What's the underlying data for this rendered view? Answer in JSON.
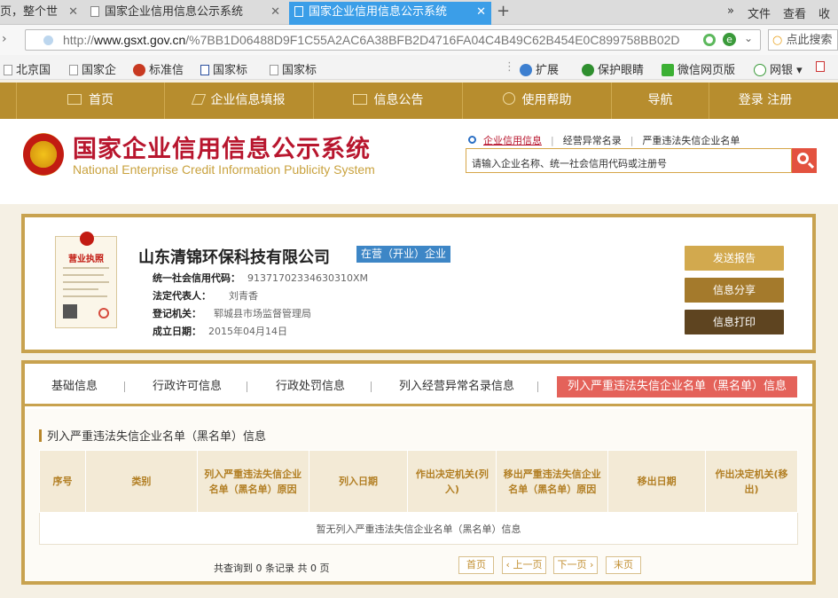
{
  "browser": {
    "tabs": [
      {
        "label": "页，整个世",
        "active": false
      },
      {
        "label": "国家企业信用信息公示系统",
        "active": false
      },
      {
        "label": "国家企业信用信息公示系统",
        "active": true
      }
    ],
    "new_tab": "+",
    "close": "✕",
    "menu": {
      "chevron": "»",
      "file": "文件",
      "view": "查看",
      "more": "收"
    },
    "url_prefix": "http://",
    "url_host": "www.gsxt.gov.cn",
    "url_path": "/%7BB1D06488D9F1C55A2AC6A38BFB2D4716FA04C4B49C62B454E0C899758BB02D",
    "search_placeholder": "点此搜索",
    "bookmarks": [
      "北京国",
      "国家企",
      "标准信",
      "国家标",
      "国家标"
    ],
    "right_tools": [
      "扩展",
      "保护眼睛",
      "微信网页版",
      "网银"
    ]
  },
  "nav": {
    "items": [
      "首页",
      "企业信息填报",
      "信息公告",
      "使用帮助",
      "导航"
    ],
    "login": "登录",
    "register": "注册"
  },
  "header": {
    "title": "国家企业信用信息公示系统",
    "subtitle": "National Enterprise Credit Information Publicity System",
    "search_tabs": [
      "企业信用信息",
      "经营异常名录",
      "严重违法失信企业名单"
    ],
    "search_placeholder": "请输入企业名称、统一社会信用代码或注册号"
  },
  "company": {
    "license_title": "营业执照",
    "name": "山东清锦环保科技有限公司",
    "status": "在营（开业）企业",
    "fields": [
      {
        "label": "统一社会信用代码：",
        "value": "91371702334630310XM"
      },
      {
        "label": "法定代表人：",
        "value": "刘青香"
      },
      {
        "label": "登记机关：",
        "value": "郓城县市场监督管理局"
      },
      {
        "label": "成立日期：",
        "value": "2015年04月14日"
      }
    ],
    "actions": [
      "发送报告",
      "信息分享",
      "信息打印"
    ],
    "action_colors": [
      "#d2a94e",
      "#a47a2c",
      "#5e4420"
    ]
  },
  "panel": {
    "tabs": [
      "基础信息",
      "行政许可信息",
      "行政处罚信息",
      "列入经营异常名录信息",
      "列入严重违法失信企业名单（黑名单）信息"
    ],
    "section_title": "列入严重违法失信企业名单（黑名单）信息",
    "columns": [
      "序号",
      "类别",
      "列入严重违法失信企业名单（黑名单）原因",
      "列入日期",
      "作出决定机关(列入)",
      "移出严重违法失信企业名单（黑名单）原因",
      "移出日期",
      "作出决定机关(移出)"
    ],
    "empty_text": "暂无列入严重违法失信企业名单（黑名单）信息",
    "pager_info": "共查询到 0 条记录 共 0 页",
    "pager": [
      "首页",
      "‹ 上一页",
      "下一页 ›",
      "末页"
    ]
  }
}
